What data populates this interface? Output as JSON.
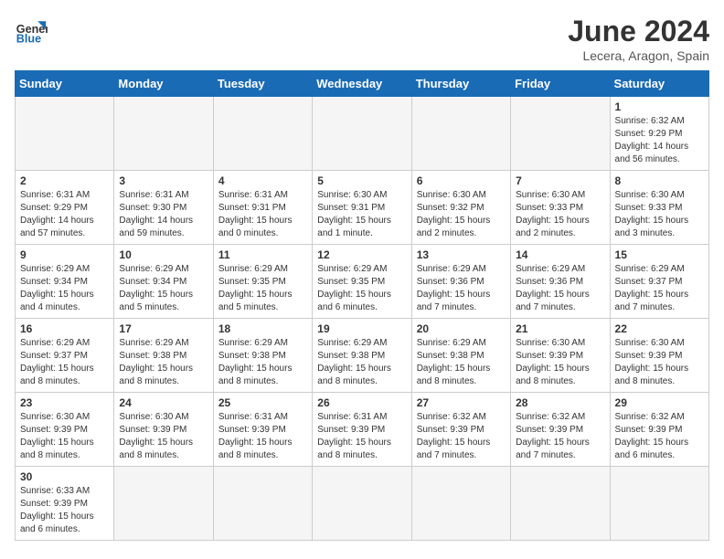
{
  "header": {
    "logo_general": "General",
    "logo_blue": "Blue",
    "month_title": "June 2024",
    "subtitle": "Lecera, Aragon, Spain"
  },
  "weekdays": [
    "Sunday",
    "Monday",
    "Tuesday",
    "Wednesday",
    "Thursday",
    "Friday",
    "Saturday"
  ],
  "weeks": [
    [
      {
        "day": "",
        "info": ""
      },
      {
        "day": "",
        "info": ""
      },
      {
        "day": "",
        "info": ""
      },
      {
        "day": "",
        "info": ""
      },
      {
        "day": "",
        "info": ""
      },
      {
        "day": "",
        "info": ""
      },
      {
        "day": "1",
        "info": "Sunrise: 6:32 AM\nSunset: 9:29 PM\nDaylight: 14 hours and 56 minutes."
      }
    ],
    [
      {
        "day": "2",
        "info": "Sunrise: 6:31 AM\nSunset: 9:29 PM\nDaylight: 14 hours and 57 minutes."
      },
      {
        "day": "3",
        "info": "Sunrise: 6:31 AM\nSunset: 9:30 PM\nDaylight: 14 hours and 59 minutes."
      },
      {
        "day": "4",
        "info": "Sunrise: 6:31 AM\nSunset: 9:31 PM\nDaylight: 15 hours and 0 minutes."
      },
      {
        "day": "5",
        "info": "Sunrise: 6:30 AM\nSunset: 9:31 PM\nDaylight: 15 hours and 1 minute."
      },
      {
        "day": "6",
        "info": "Sunrise: 6:30 AM\nSunset: 9:32 PM\nDaylight: 15 hours and 2 minutes."
      },
      {
        "day": "7",
        "info": "Sunrise: 6:30 AM\nSunset: 9:33 PM\nDaylight: 15 hours and 2 minutes."
      },
      {
        "day": "8",
        "info": "Sunrise: 6:30 AM\nSunset: 9:33 PM\nDaylight: 15 hours and 3 minutes."
      }
    ],
    [
      {
        "day": "9",
        "info": "Sunrise: 6:29 AM\nSunset: 9:34 PM\nDaylight: 15 hours and 4 minutes."
      },
      {
        "day": "10",
        "info": "Sunrise: 6:29 AM\nSunset: 9:34 PM\nDaylight: 15 hours and 5 minutes."
      },
      {
        "day": "11",
        "info": "Sunrise: 6:29 AM\nSunset: 9:35 PM\nDaylight: 15 hours and 5 minutes."
      },
      {
        "day": "12",
        "info": "Sunrise: 6:29 AM\nSunset: 9:35 PM\nDaylight: 15 hours and 6 minutes."
      },
      {
        "day": "13",
        "info": "Sunrise: 6:29 AM\nSunset: 9:36 PM\nDaylight: 15 hours and 7 minutes."
      },
      {
        "day": "14",
        "info": "Sunrise: 6:29 AM\nSunset: 9:36 PM\nDaylight: 15 hours and 7 minutes."
      },
      {
        "day": "15",
        "info": "Sunrise: 6:29 AM\nSunset: 9:37 PM\nDaylight: 15 hours and 7 minutes."
      }
    ],
    [
      {
        "day": "16",
        "info": "Sunrise: 6:29 AM\nSunset: 9:37 PM\nDaylight: 15 hours and 8 minutes."
      },
      {
        "day": "17",
        "info": "Sunrise: 6:29 AM\nSunset: 9:38 PM\nDaylight: 15 hours and 8 minutes."
      },
      {
        "day": "18",
        "info": "Sunrise: 6:29 AM\nSunset: 9:38 PM\nDaylight: 15 hours and 8 minutes."
      },
      {
        "day": "19",
        "info": "Sunrise: 6:29 AM\nSunset: 9:38 PM\nDaylight: 15 hours and 8 minutes."
      },
      {
        "day": "20",
        "info": "Sunrise: 6:29 AM\nSunset: 9:38 PM\nDaylight: 15 hours and 8 minutes."
      },
      {
        "day": "21",
        "info": "Sunrise: 6:30 AM\nSunset: 9:39 PM\nDaylight: 15 hours and 8 minutes."
      },
      {
        "day": "22",
        "info": "Sunrise: 6:30 AM\nSunset: 9:39 PM\nDaylight: 15 hours and 8 minutes."
      }
    ],
    [
      {
        "day": "23",
        "info": "Sunrise: 6:30 AM\nSunset: 9:39 PM\nDaylight: 15 hours and 8 minutes."
      },
      {
        "day": "24",
        "info": "Sunrise: 6:30 AM\nSunset: 9:39 PM\nDaylight: 15 hours and 8 minutes."
      },
      {
        "day": "25",
        "info": "Sunrise: 6:31 AM\nSunset: 9:39 PM\nDaylight: 15 hours and 8 minutes."
      },
      {
        "day": "26",
        "info": "Sunrise: 6:31 AM\nSunset: 9:39 PM\nDaylight: 15 hours and 8 minutes."
      },
      {
        "day": "27",
        "info": "Sunrise: 6:32 AM\nSunset: 9:39 PM\nDaylight: 15 hours and 7 minutes."
      },
      {
        "day": "28",
        "info": "Sunrise: 6:32 AM\nSunset: 9:39 PM\nDaylight: 15 hours and 7 minutes."
      },
      {
        "day": "29",
        "info": "Sunrise: 6:32 AM\nSunset: 9:39 PM\nDaylight: 15 hours and 6 minutes."
      }
    ],
    [
      {
        "day": "30",
        "info": "Sunrise: 6:33 AM\nSunset: 9:39 PM\nDaylight: 15 hours and 6 minutes."
      },
      {
        "day": "",
        "info": ""
      },
      {
        "day": "",
        "info": ""
      },
      {
        "day": "",
        "info": ""
      },
      {
        "day": "",
        "info": ""
      },
      {
        "day": "",
        "info": ""
      },
      {
        "day": "",
        "info": ""
      }
    ]
  ]
}
